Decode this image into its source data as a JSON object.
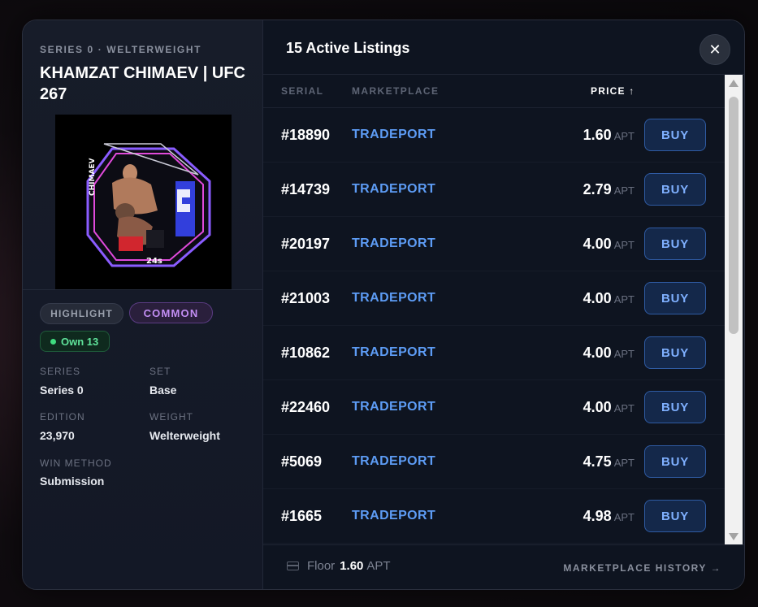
{
  "left": {
    "series_line": "SERIES 0 · WELTERWEIGHT",
    "title": "KHAMZAT CHIMAEV | UFC 267",
    "image_caption": "CHIMAEV",
    "image_tag": "24s",
    "tags": {
      "highlight": "HIGHLIGHT",
      "rarity": "COMMON"
    },
    "own": "Own 13",
    "meta": {
      "series_label": "SERIES",
      "series_value": "Series 0",
      "set_label": "SET",
      "set_value": "Base",
      "edition_label": "EDITION",
      "edition_value": "23,970",
      "weight_label": "WEIGHT",
      "weight_value": "Welterweight",
      "win_label": "WIN METHOD",
      "win_value": "Submission"
    }
  },
  "right": {
    "title": "15 Active Listings",
    "close_icon": "close-icon",
    "columns": {
      "serial": "SERIAL",
      "marketplace": "MARKETPLACE",
      "price": "PRICE ↑"
    },
    "unit": "APT",
    "buy_label": "BUY",
    "listings": [
      {
        "serial": "#18890",
        "market": "TRADEPORT",
        "price": "1.60"
      },
      {
        "serial": "#14739",
        "market": "TRADEPORT",
        "price": "2.79"
      },
      {
        "serial": "#20197",
        "market": "TRADEPORT",
        "price": "4.00"
      },
      {
        "serial": "#21003",
        "market": "TRADEPORT",
        "price": "4.00"
      },
      {
        "serial": "#10862",
        "market": "TRADEPORT",
        "price": "4.00"
      },
      {
        "serial": "#22460",
        "market": "TRADEPORT",
        "price": "4.00"
      },
      {
        "serial": "#5069",
        "market": "TRADEPORT",
        "price": "4.75"
      },
      {
        "serial": "#1665",
        "market": "TRADEPORT",
        "price": "4.98"
      }
    ],
    "footer": {
      "floor_label": "Floor",
      "floor_value": "1.60",
      "floor_unit": "APT",
      "history": "MARKETPLACE HISTORY →"
    }
  },
  "colors": {
    "accent": "#5d9cf5",
    "rarity": "#c28ef3",
    "own": "#5fe39a",
    "background": "#0e1420"
  }
}
